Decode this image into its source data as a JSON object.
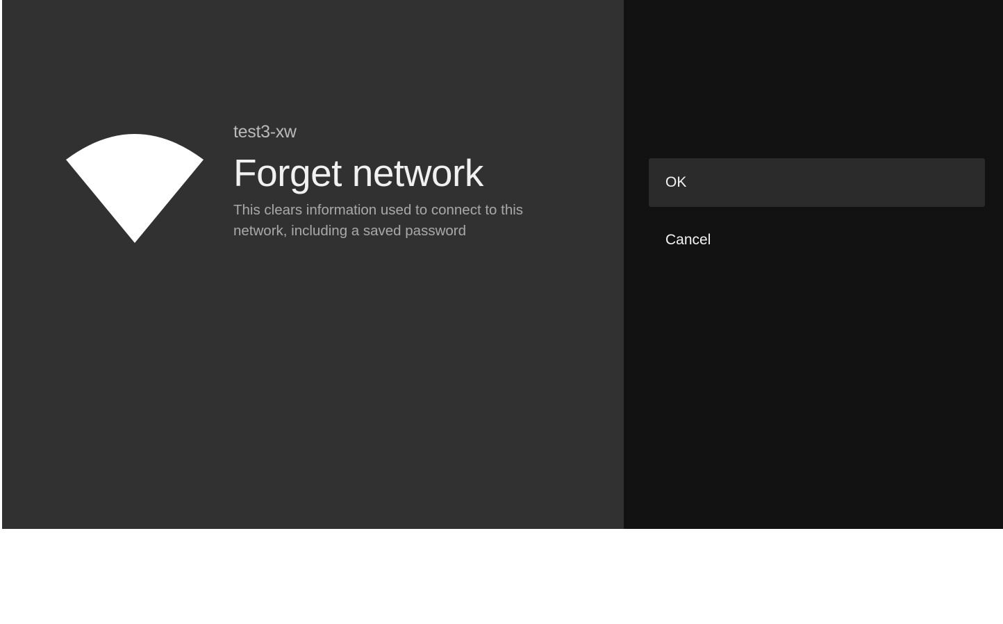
{
  "network": {
    "ssid": "test3-xw",
    "icon": "wifi-signal-icon"
  },
  "dialog": {
    "title": "Forget network",
    "description_line1": "This clears information used to connect to this",
    "description_line2": "network, including a saved password"
  },
  "actions": [
    {
      "label": "OK",
      "focused": true
    },
    {
      "label": "Cancel",
      "focused": false
    }
  ],
  "colors": {
    "left_background": "#313131",
    "right_background": "#121212",
    "focused_action": "#2b2b2b",
    "icon": "#ffffff"
  }
}
